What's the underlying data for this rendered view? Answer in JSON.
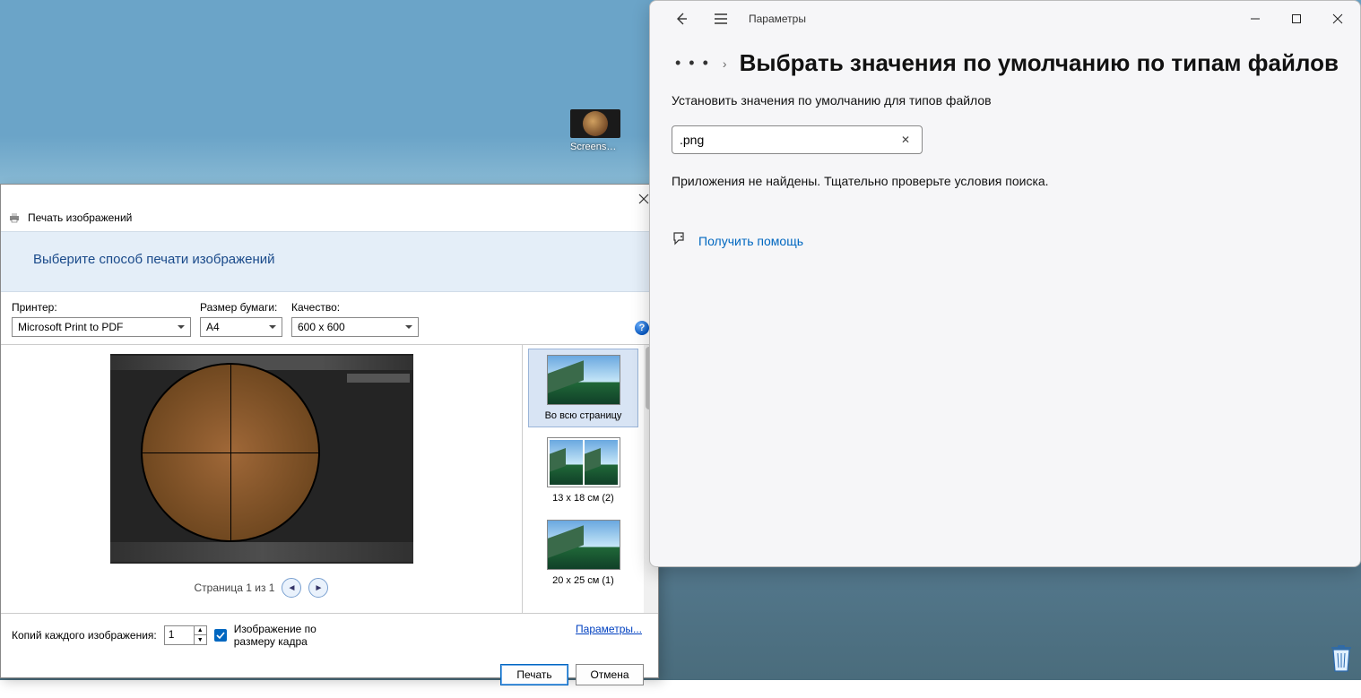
{
  "desktop": {
    "icon_label": "Screenshot_…",
    "recycle_bin": "Корзина"
  },
  "print_dialog": {
    "title": "Печать изображений",
    "close_icon": "close",
    "instruction": "Выберите способ печати изображений",
    "printer_label": "Принтер:",
    "printer_value": "Microsoft Print to PDF",
    "paper_label": "Размер бумаги:",
    "paper_value": "A4",
    "quality_label": "Качество:",
    "quality_value": "600 x 600",
    "help_icon": "?",
    "page_info": "Страница 1 из 1",
    "prev_icon": "◄",
    "next_icon": "►",
    "layouts": [
      {
        "label": "Во всю страницу",
        "selected": true
      },
      {
        "label": "13 x 18 см (2)",
        "selected": false
      },
      {
        "label": "20 x 25 см (1)",
        "selected": false
      }
    ],
    "copies_label": "Копий каждого изображения:",
    "copies_value": "1",
    "fit_label": "Изображение по размеру кадра",
    "fit_checked": true,
    "params_link": "Параметры...",
    "print_btn": "Печать",
    "cancel_btn": "Отмена"
  },
  "settings": {
    "app_name": "Параметры",
    "back_icon": "←",
    "menu_icon": "≡",
    "min_icon": "—",
    "max_icon": "□",
    "close_icon": "✕",
    "breadcrumb_dots": "• • •",
    "breadcrumb_chevron": "›",
    "heading": "Выбрать значения по умолчанию по типам файлов",
    "subtitle": "Установить значения по умолчанию для типов файлов",
    "search_value": ".png",
    "search_placeholder": "",
    "clear_icon": "✕",
    "not_found": "Приложения не найдены. Тщательно проверьте условия поиска.",
    "help_link": "Получить помощь"
  }
}
